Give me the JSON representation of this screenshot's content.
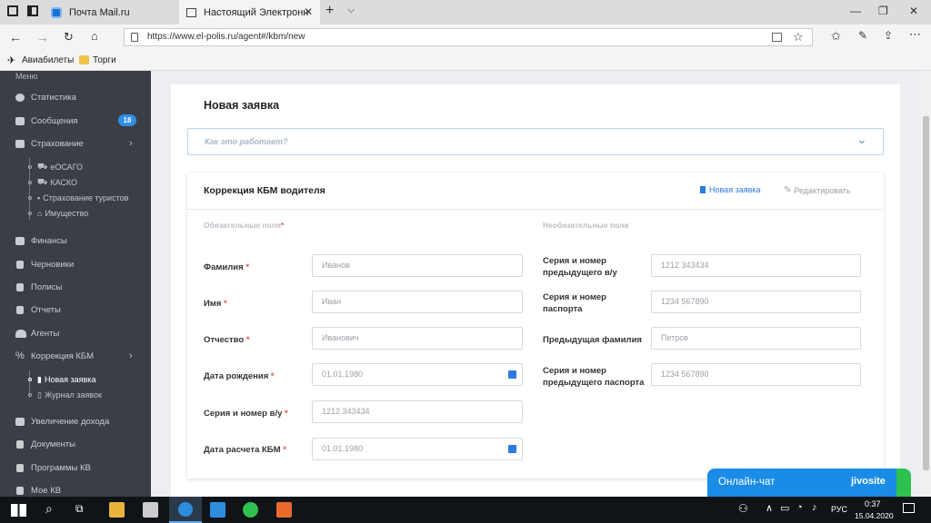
{
  "browser": {
    "tabs": [
      {
        "label": "Почта Mail.ru"
      },
      {
        "label": "Настоящий Электронн"
      }
    ],
    "url": "https://www.el-polis.ru/agent#/kbm/new",
    "bookmarks": [
      "Авиабилеты",
      "Торги"
    ]
  },
  "sidebar": {
    "header": "Меню",
    "items": [
      {
        "label": "Статистика"
      },
      {
        "label": "Сообщения",
        "badge": "18"
      },
      {
        "label": "Страхование"
      },
      {
        "label": "Финансы"
      },
      {
        "label": "Черновики"
      },
      {
        "label": "Полисы"
      },
      {
        "label": "Отчеты"
      },
      {
        "label": "Агенты"
      },
      {
        "label": "Коррекция КБМ"
      },
      {
        "label": "Увеличение дохода"
      },
      {
        "label": "Документы"
      },
      {
        "label": "Программы КВ"
      },
      {
        "label": "Мое КВ"
      }
    ],
    "insurance_sub": [
      "еОСАГО",
      "КАСКО",
      "Страхование туристов",
      "Имущество"
    ],
    "kbm_sub": [
      "Новая заявка",
      "Журнал заявок"
    ]
  },
  "page": {
    "title": "Новая заявка",
    "how_it_works": "Как это работает?",
    "card_title": "Коррекция КБМ водителя",
    "action_new": "Новая заявка",
    "action_edit": "Редактировать",
    "required_header": "Обязательные поля",
    "optional_header": "Необязательные поля",
    "req_star": "*"
  },
  "required_fields": [
    {
      "label": "Фамилия",
      "placeholder": "Иванов"
    },
    {
      "label": "Имя",
      "placeholder": "Иван"
    },
    {
      "label": "Отчество",
      "placeholder": "Иванович"
    },
    {
      "label": "Дата рождения",
      "placeholder": "01.01.1980"
    },
    {
      "label": "Серия и номер в/у",
      "placeholder": "1212 343434"
    },
    {
      "label": "Дата расчета КБМ",
      "placeholder": "01.01.1980"
    }
  ],
  "optional_fields": [
    {
      "label": "Серия и номер предыдущего в/у",
      "placeholder": "1212 343434"
    },
    {
      "label": "Серия и номер паспорта",
      "placeholder": "1234 567890"
    },
    {
      "label": "Предыдущая фамилия",
      "placeholder": "Петров"
    },
    {
      "label": "Серия и номер предыдущего паспорта",
      "placeholder": "1234 567890"
    }
  ],
  "chat": {
    "label": "Онлайн-чат",
    "brand": "jivosite"
  },
  "taskbar": {
    "lang": "РУС",
    "time": "0:37",
    "date": "15.04.2020"
  }
}
